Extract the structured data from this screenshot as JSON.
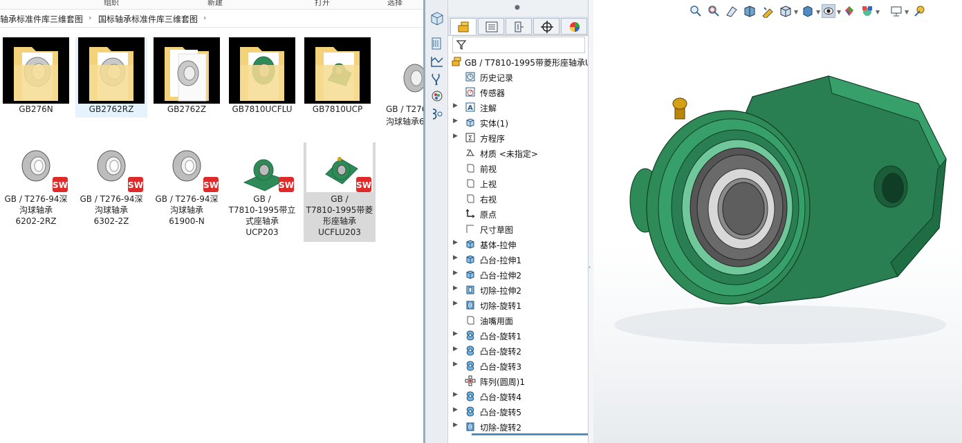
{
  "explorer": {
    "ribbon": [
      "组织",
      "新建",
      "打开",
      "选择"
    ],
    "breadcrumb": [
      "轴承标准件库三维套图",
      "国标轴承标准件库三维套图"
    ],
    "folders": [
      {
        "label": "GB276N",
        "thumb": "bearing-gray"
      },
      {
        "label": "GB2762RZ",
        "thumb": "bearing-gray",
        "selected": true
      },
      {
        "label": "GB2762Z",
        "thumb": "bearing-gray-doc"
      },
      {
        "label": "GB7810UCFLU",
        "thumb": "bearing-green-flange"
      },
      {
        "label": "GB7810UCP",
        "thumb": "bearing-green-pillow"
      }
    ],
    "partial_file": {
      "line1": "GB / T276",
      "line2": "沟球轴承6"
    },
    "files": [
      {
        "lines": [
          "GB / T276-94深",
          "沟球轴承",
          "6202-2RZ"
        ],
        "thumb": "bearing"
      },
      {
        "lines": [
          "GB / T276-94深",
          "沟球轴承",
          "6302-2Z"
        ],
        "thumb": "bearing"
      },
      {
        "lines": [
          "GB / T276-94深",
          "沟球轴承",
          "61900-N"
        ],
        "thumb": "bearing"
      },
      {
        "lines": [
          "GB /",
          "T7810-1995带立",
          "式座轴承",
          "UCP203"
        ],
        "thumb": "pillow"
      },
      {
        "lines": [
          "GB /",
          "T7810-1995带菱",
          "形座轴承",
          "UCFLU203"
        ],
        "thumb": "flange",
        "hovered": true
      }
    ],
    "sw_badge": "SW"
  },
  "feature_manager": {
    "root": "GB / T7810-1995带菱形座轴承U",
    "items": [
      {
        "label": "历史记录",
        "icon": "history-icon",
        "expand": false
      },
      {
        "label": "传感器",
        "icon": "sensor-icon",
        "expand": false
      },
      {
        "label": "注解",
        "icon": "annotation-icon",
        "expand": true
      },
      {
        "label": "实体(1)",
        "icon": "solid-body-icon",
        "expand": true
      },
      {
        "label": "方程序",
        "icon": "equation-icon",
        "expand": true
      },
      {
        "label": "材质 <未指定>",
        "icon": "material-icon",
        "expand": false
      },
      {
        "label": "前视",
        "icon": "plane-icon",
        "expand": false
      },
      {
        "label": "上视",
        "icon": "plane-icon",
        "expand": false
      },
      {
        "label": "右视",
        "icon": "plane-icon",
        "expand": false
      },
      {
        "label": "原点",
        "icon": "origin-icon",
        "expand": false
      },
      {
        "label": "尺寸草图",
        "icon": "sketch-icon",
        "expand": false
      },
      {
        "label": "基体-拉伸",
        "icon": "extrude-icon",
        "expand": true
      },
      {
        "label": "凸台-拉伸1",
        "icon": "extrude-icon",
        "expand": true
      },
      {
        "label": "凸台-拉伸2",
        "icon": "extrude-icon",
        "expand": true
      },
      {
        "label": "切除-拉伸2",
        "icon": "cut-extrude-icon",
        "expand": true
      },
      {
        "label": "切除-旋转1",
        "icon": "cut-revolve-icon",
        "expand": true
      },
      {
        "label": "油嘴用面",
        "icon": "plane-icon",
        "expand": false
      },
      {
        "label": "凸台-旋转1",
        "icon": "revolve-icon",
        "expand": true
      },
      {
        "label": "凸台-旋转2",
        "icon": "revolve-icon",
        "expand": true
      },
      {
        "label": "凸台-旋转3",
        "icon": "revolve-icon",
        "expand": true
      },
      {
        "label": "阵列(圆周)1",
        "icon": "pattern-icon",
        "expand": false
      },
      {
        "label": "凸台-旋转4",
        "icon": "revolve-icon",
        "expand": true
      },
      {
        "label": "凸台-旋转5",
        "icon": "revolve-icon",
        "expand": true
      },
      {
        "label": "切除-旋转2",
        "icon": "cut-revolve-icon",
        "expand": true
      }
    ]
  },
  "colors": {
    "bearing_green": "#2e8b57",
    "bearing_green_dark": "#1f6e43",
    "accent_blue": "#1c6bb0",
    "folder_yellow": "#f3d27a",
    "sw_red": "#e02a2a"
  }
}
